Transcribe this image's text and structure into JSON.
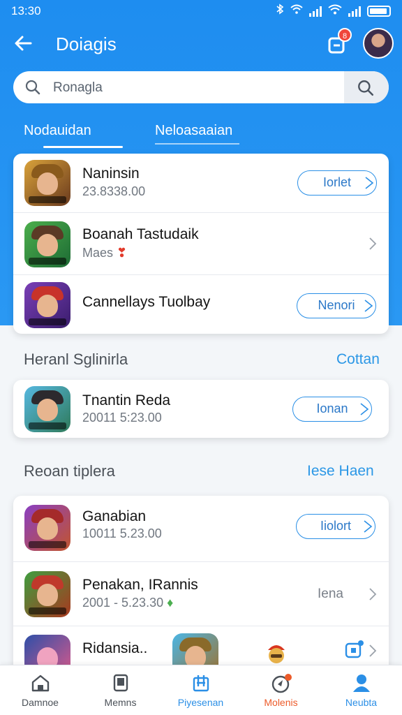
{
  "status": {
    "time": "13:30"
  },
  "header": {
    "title": "Doiagis",
    "notification_badge": "8"
  },
  "search": {
    "placeholder": "Ronagla"
  },
  "tabs": [
    {
      "label": "Nodauidan"
    },
    {
      "label": "Neloasaaian"
    }
  ],
  "top_list": [
    {
      "name": "Naninsin",
      "sub": "23.8338.00",
      "action": "Iorlet",
      "action_type": "pill"
    },
    {
      "name": "Boanah Tastudaik",
      "sub": "Maes",
      "action_type": "chevron"
    },
    {
      "name": "Cannellays Tuolbay",
      "sub": "",
      "action": "Nenori",
      "action_type": "pill"
    }
  ],
  "section1": {
    "title": "Heranl Sglinirla",
    "link": "Cottan",
    "items": [
      {
        "name": "Tnantin Reda",
        "sub": "20011 5:23.00",
        "action": "Ionan",
        "action_type": "pill"
      }
    ]
  },
  "section2": {
    "title": "Reoan tiplera",
    "link": "Iese Haen",
    "items": [
      {
        "name": "Ganabian",
        "sub": "10011 5.23.00",
        "action": "Iiolort",
        "action_type": "pill"
      },
      {
        "name": "Penakan, IRannis",
        "sub": "2001 - 5.23.30",
        "action": "Iena",
        "action_type": "text-chevron"
      },
      {
        "name": "Ridansia..",
        "sub": "",
        "action_type": "chevron"
      }
    ]
  },
  "bottom_nav": [
    {
      "label": "Damnoe",
      "icon": "home-icon"
    },
    {
      "label": "Memns",
      "icon": "tablet-icon"
    },
    {
      "label": "Piyesenan",
      "icon": "library-icon"
    },
    {
      "label": "Molenis",
      "icon": "moments-icon"
    },
    {
      "label": "Neubta",
      "icon": "profile-icon"
    }
  ],
  "colors": {
    "primary": "#1e8df0",
    "accent": "#2b97e6",
    "alert": "#ec5b2a"
  }
}
